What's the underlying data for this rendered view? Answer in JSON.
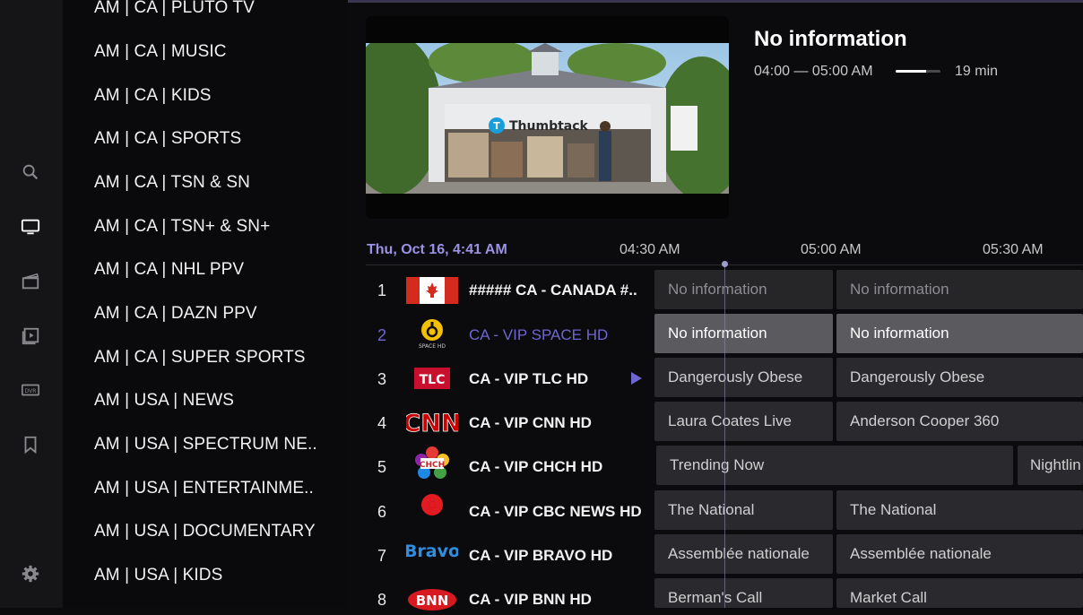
{
  "categories": [
    "AM | CA | PLUTO TV",
    "AM | CA | MUSIC",
    "AM | CA | KIDS",
    "AM | CA | SPORTS",
    "AM | CA | TSN & SN",
    "AM | CA | TSN+ & SN+",
    "AM | CA | NHL PPV",
    "AM | CA | DAZN PPV",
    "AM | CA | SUPER SPORTS",
    "AM | USA | NEWS",
    "AM | USA | SPECTRUM NE..",
    "AM | USA | ENTERTAINME..",
    "AM | USA | DOCUMENTARY",
    "AM | USA | KIDS"
  ],
  "rail_icons": [
    "search-icon",
    "tv-icon",
    "movies-icon",
    "series-icon",
    "dvr-icon",
    "bookmark-icon",
    "settings-icon"
  ],
  "preview": {
    "brand": "Thumbtack",
    "title": "No information",
    "time_range": "04:00 — 05:00 AM",
    "progress": 0.67,
    "remaining": "19 min"
  },
  "timeline": {
    "date": "Thu, Oct 16, 4:41 AM",
    "slots": [
      "04:30 AM",
      "05:00 AM",
      "05:30 AM"
    ]
  },
  "channels": [
    {
      "num": "1",
      "name": "##### CA - CANADA #..",
      "programs": [
        "No information",
        "No information"
      ]
    },
    {
      "num": "2",
      "name": "CA - VIP SPACE HD",
      "programs": [
        "No information",
        "No information"
      ],
      "logo_text": "SPACE HD"
    },
    {
      "num": "3",
      "name": "CA - VIP TLC HD",
      "programs": [
        "Dangerously Obese",
        "Dangerously Obese"
      ],
      "logo_text": "TLC"
    },
    {
      "num": "4",
      "name": "CA - VIP CNN HD",
      "programs": [
        "Laura Coates Live",
        "Anderson Cooper 360"
      ],
      "logo_text": "CNN"
    },
    {
      "num": "5",
      "name": "CA - VIP CHCH HD",
      "programs": [
        "Trending Now",
        "Nightlin"
      ],
      "logo_text": "CHCH"
    },
    {
      "num": "6",
      "name": "CA - VIP CBC NEWS HD",
      "programs": [
        "The National",
        "The National"
      ]
    },
    {
      "num": "7",
      "name": "CA - VIP BRAVO HD",
      "programs": [
        "Assemblée nationale",
        "Assemblée nationale"
      ],
      "logo_text": "Bravo"
    },
    {
      "num": "8",
      "name": "CA - VIP BNN HD",
      "programs": [
        "Berman's Call",
        "Market Call"
      ],
      "logo_text": "BNN"
    }
  ],
  "colors": {
    "accent": "#6e66d0",
    "cell": "#2a2a2e",
    "cell_active": "#5b5b5f"
  }
}
